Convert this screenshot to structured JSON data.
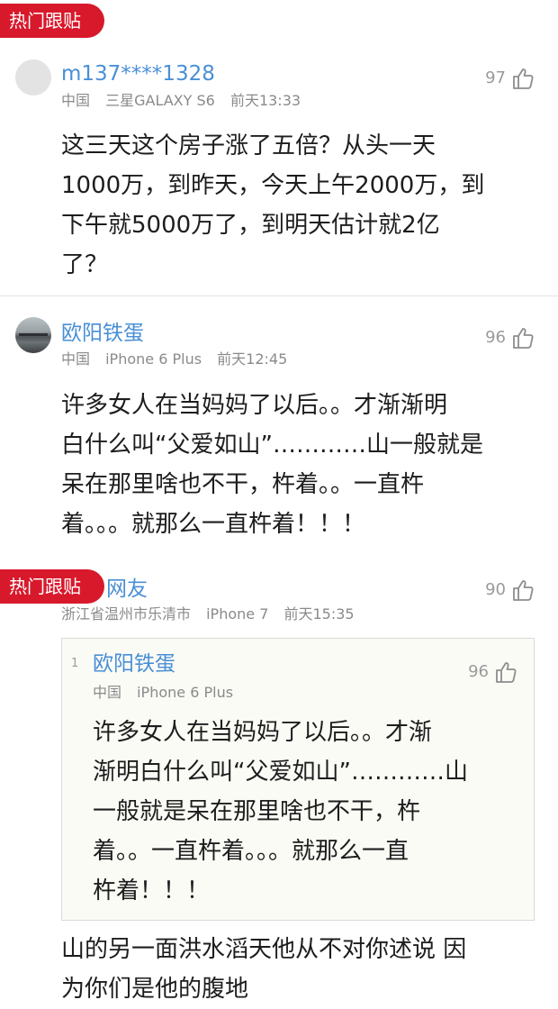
{
  "badge": "热门跟贴",
  "comments": [
    {
      "username": "m137****1328",
      "location": "中国",
      "device": "三星GALAXY S6",
      "time": "前天13:33",
      "likes": "97",
      "text": "这三天这个房子涨了五倍？从头一天\n1000万，到昨天，今天上午2000万，到\n下午就5000万了，到明天估计就2亿\n了？"
    },
    {
      "username": "欧阳铁蛋",
      "location": "中国",
      "device": "iPhone 6 Plus",
      "time": "前天12:45",
      "likes": "96",
      "text": "许多女人在当妈妈了以后。。才渐渐明\n白什么叫“父爱如山”…………山一般就是\n呆在那里啥也不干，杵着。。一直杵\n着。。。就那么一直杵着！！！"
    },
    {
      "username": "网友",
      "location": "浙江省温州市乐清市",
      "device": "iPhone 7",
      "time": "前天15:35",
      "likes": "90",
      "quote": {
        "floor": "1",
        "username": "欧阳铁蛋",
        "location": "中国",
        "device": "iPhone 6 Plus",
        "likes": "96",
        "text": "许多女人在当妈妈了以后。。才渐\n渐明白什么叫“父爱如山”…………山\n一般就是呆在那里啥也不干，杵\n着。。一直杵着。。。就那么一直\n杵着！！！"
      },
      "text": "山的另一面洪水滔天他从不对你述说 因\n为你们是他的腹地"
    }
  ],
  "colors": {
    "badge": "#d8192c",
    "username": "#4a8fd6",
    "meta": "#8a8a8a"
  },
  "icons": {
    "like": "thumbs-up-icon"
  }
}
